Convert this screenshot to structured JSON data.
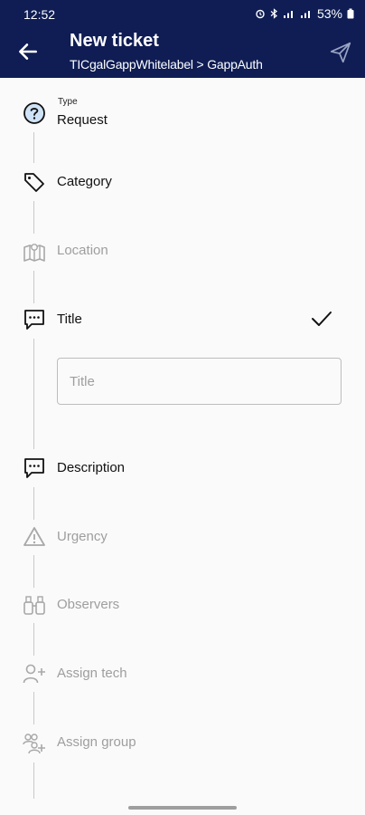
{
  "status_bar": {
    "time": "12:52",
    "battery": "53%",
    "icons": [
      "alarm-icon",
      "bluetooth-icon",
      "signal-icon",
      "wifi-icon",
      "battery-icon"
    ]
  },
  "app_bar": {
    "title": "New ticket",
    "subtitle": "TICgalGappWhitelabel > GappAuth",
    "back_icon": "arrow-left-icon",
    "send_icon": "send-icon",
    "color": "#0f1d54"
  },
  "form": {
    "type": {
      "caption": "Type",
      "value": "Request",
      "icon": "question-circle-icon"
    },
    "category": {
      "label": "Category",
      "icon": "tag-icon"
    },
    "location": {
      "label": "Location",
      "icon": "map-icon"
    },
    "title": {
      "label": "Title",
      "icon": "chat-bubble-icon",
      "placeholder": "Title",
      "value": ""
    },
    "description": {
      "label": "Description",
      "icon": "chat-bubble-icon"
    },
    "urgency": {
      "label": "Urgency",
      "icon": "warning-icon"
    },
    "observers": {
      "label": "Observers",
      "icon": "binoculars-icon"
    },
    "assign_tech": {
      "label": "Assign tech",
      "icon": "person-add-icon"
    },
    "assign_group": {
      "label": "Assign group",
      "icon": "group-add-icon"
    }
  }
}
